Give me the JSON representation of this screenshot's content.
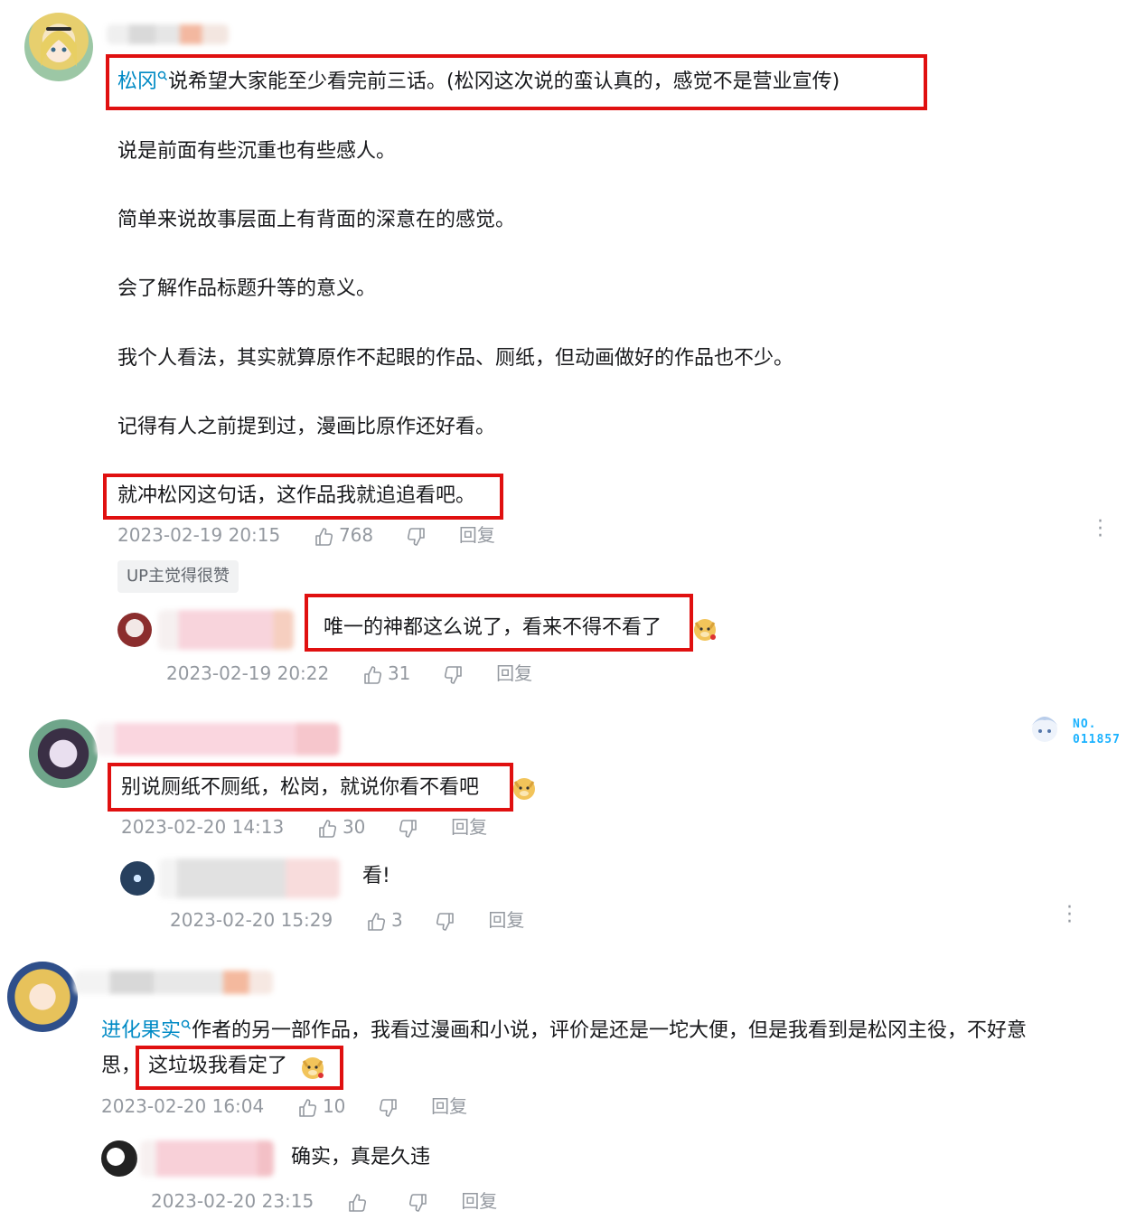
{
  "comments": [
    {
      "mention": "松冈",
      "text_after_mention": "说希望大家能至少看完前三话。(松冈这次说的蛮认真的，感觉不是营业宣传)",
      "paragraphs": [
        "说是前面有些沉重也有些感人。",
        "简单来说故事层面上有背面的深意在的感觉。",
        "会了解作品标题升等的意义。",
        "我个人看法，其实就算原作不起眼的作品、厕纸，但动画做好的作品也不少。",
        "记得有人之前提到过，漫画比原作还好看。",
        "就冲松冈这句话，这作品我就追追看吧。"
      ],
      "time": "2023-02-19 20:15",
      "likes": "768",
      "reply_label": "回复",
      "badge": "UP主觉得很赞",
      "replies": [
        {
          "text": "唯一的神都这么说了，看来不得不看了",
          "time": "2023-02-19 20:22",
          "likes": "31",
          "reply_label": "回复"
        }
      ]
    },
    {
      "text": "别说厕纸不厕纸，松岗，就说你看不看吧",
      "time": "2023-02-20 14:13",
      "likes": "30",
      "reply_label": "回复",
      "fan_label": "NO.",
      "fan_number": "011857",
      "replies": [
        {
          "text": "看!",
          "time": "2023-02-20 15:29",
          "likes": "3",
          "reply_label": "回复"
        }
      ]
    },
    {
      "mention": "进化果实",
      "line1_after_mention": "作者的另一部作品，我看过漫画和小说，评价是还是一坨大便，但是我看到是松冈主役，不好意",
      "line2_prefix": "思，",
      "line2_highlight": "这垃圾我看定了",
      "time": "2023-02-20 16:04",
      "likes": "10",
      "reply_label": "回复",
      "replies": [
        {
          "text": "确实，真是久违",
          "time": "2023-02-20 23:15",
          "likes": "",
          "reply_label": "回复"
        }
      ]
    }
  ],
  "colors": {
    "link": "#008ac5",
    "highlight_border": "#e01010",
    "meta": "#9499a0",
    "fan_badge": "#1ab2ff"
  },
  "icons": [
    "search-icon",
    "thumbs-up-icon",
    "thumbs-down-icon",
    "more-icon",
    "doge-emoji"
  ]
}
